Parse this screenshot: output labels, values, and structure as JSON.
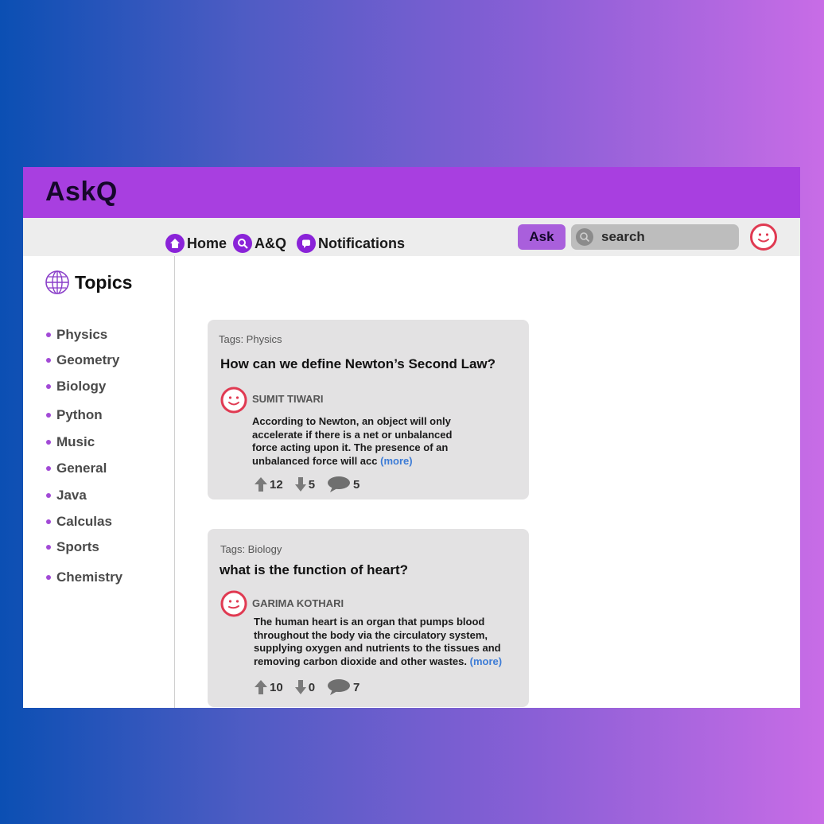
{
  "app": {
    "title": "AskQ"
  },
  "nav": {
    "home_label": "Home",
    "aq_label": "A&Q",
    "notifications_label": "Notifications",
    "ask_label": "Ask",
    "search_placeholder": "search"
  },
  "sidebar": {
    "title": "Topics",
    "topics": [
      "Physics",
      "Geometry",
      "Biology",
      "Python",
      "Music",
      "General",
      "Java",
      "Calculas",
      "Sports",
      "Chemistry"
    ]
  },
  "questions": [
    {
      "tags": "Tags: Physics",
      "title": "How can we define Newton’s Second Law?",
      "author": "SUMIT TIWARI",
      "answer_lines": [
        "According to Newton, an object will only",
        "accelerate if there is a net or unbalanced",
        "force acting upon it. The presence of an",
        "unbalanced force will acc"
      ],
      "more": "(more)",
      "upvotes": "12",
      "downvotes": "5",
      "comments": "5"
    },
    {
      "tags": "Tags: Biology",
      "title": "what is the function of heart?",
      "author": "GARIMA KOTHARI",
      "answer_lines": [
        "The human heart is an organ that pumps blood",
        "throughout the body via the circulatory system,",
        "supplying oxygen and nutrients to the tissues and",
        "removing carbon dioxide and other wastes."
      ],
      "more": "(more)",
      "upvotes": "10",
      "downvotes": "0",
      "comments": "7"
    }
  ],
  "colors": {
    "header": "#a83fe0",
    "nav_icon": "#8a23d8",
    "accent_link": "#3d7cd6",
    "avatar": "#e03a52"
  }
}
